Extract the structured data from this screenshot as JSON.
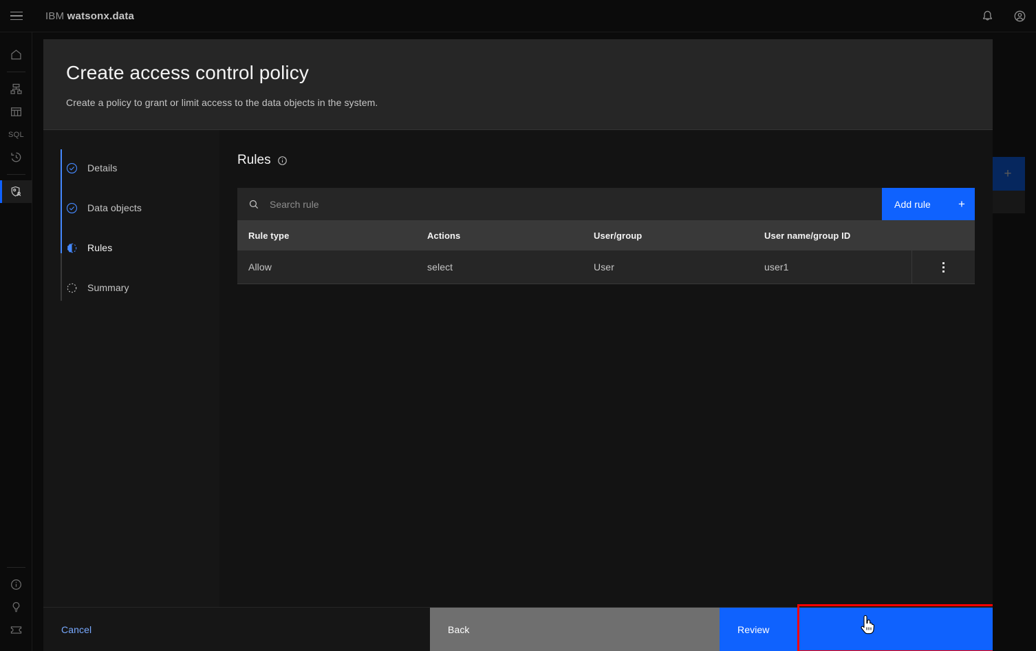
{
  "header": {
    "menu_icon": "hamburger-icon",
    "brand_prefix": "IBM",
    "brand_name": "watsonx.data",
    "notifications_icon": "bell-icon",
    "account_icon": "user-avatar-icon"
  },
  "rail": {
    "items": [
      {
        "name": "home",
        "icon": "home-icon",
        "label": "Home"
      },
      {
        "name": "infrastructure",
        "icon": "infrastructure-icon",
        "label": "Infrastructure manager"
      },
      {
        "name": "data-manager",
        "icon": "data-table-icon",
        "label": "Data manager"
      },
      {
        "name": "query-workspace",
        "icon": "sql-icon",
        "label": "SQL"
      },
      {
        "name": "query-history",
        "icon": "history-icon",
        "label": "Query history"
      },
      {
        "name": "access-control",
        "icon": "access-control-icon",
        "label": "Access control",
        "active": true
      }
    ],
    "bottom_items": [
      {
        "name": "about",
        "icon": "info-circle-icon",
        "label": "About"
      },
      {
        "name": "tips",
        "icon": "lightbulb-icon",
        "label": "Tips"
      },
      {
        "name": "support",
        "icon": "ticket-icon",
        "label": "Support"
      }
    ]
  },
  "background": {
    "add_tile_icon": "plus-icon"
  },
  "modal": {
    "title": "Create access control policy",
    "subtitle": "Create a policy to grant or limit access to the data objects in the system.",
    "steps": [
      {
        "label": "Details",
        "state": "complete",
        "icon": "check-circle-icon"
      },
      {
        "label": "Data objects",
        "state": "complete",
        "icon": "check-circle-icon"
      },
      {
        "label": "Rules",
        "state": "current",
        "icon": "half-circle-icon"
      },
      {
        "label": "Summary",
        "state": "pending",
        "icon": "dotted-circle-icon"
      }
    ],
    "content": {
      "title": "Rules",
      "title_info_icon": "info-circle-icon",
      "search": {
        "icon": "search-icon",
        "placeholder": "Search rule",
        "value": ""
      },
      "add_rule": {
        "label": "Add rule",
        "icon": "plus-icon"
      },
      "table": {
        "columns": [
          "Rule type",
          "Actions",
          "User/group",
          "User name/group ID"
        ],
        "rows": [
          {
            "rule_type": "Allow",
            "actions": "select",
            "user_group": "User",
            "user_name": "user1",
            "overflow_icon": "overflow-menu-vertical-icon"
          }
        ]
      }
    },
    "footer": {
      "cancel_label": "Cancel",
      "back_label": "Back",
      "review_label": "Review"
    }
  },
  "annotation": {
    "highlight_color": "#ff0000",
    "target": "review-button"
  },
  "colors": {
    "accent_blue": "#0f62fe",
    "link_blue": "#78a9ff",
    "step_blue": "#4589ff",
    "modal_bg": "#161616",
    "header_bg": "#262626",
    "content_bg": "#131313",
    "table_header_bg": "#393939",
    "back_btn_bg": "#6f6f6f"
  }
}
